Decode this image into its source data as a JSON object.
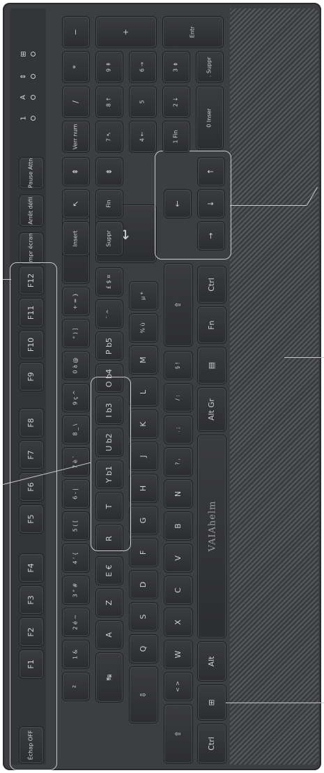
{
  "brand": "VAIAhelm",
  "indicators": [
    "1",
    "A",
    "⇕",
    "⊞"
  ],
  "keys": {
    "esc": "Échap\nOFF",
    "f1": "F1",
    "f2": "F2",
    "f3": "F3",
    "f4": "F4",
    "f5": "F5",
    "f6": "F6",
    "f7": "F7",
    "f8": "F8",
    "f9": "F9",
    "f10": "F10",
    "f11": "F11",
    "f12": "F12",
    "prt": "Impr\nécran",
    "scroll": "Arrêt\ndéfil",
    "pause": "Pause\nAttn",
    "sq": "²",
    "n1": "1 &",
    "n2": "2 é ~",
    "n3": "3 \" #",
    "n4": "4 ' {",
    "n5": "5 ( [",
    "n6": "6 - |",
    "n7": "7 è `",
    "n8": "8 _ \\",
    "n9": "9 ç ^",
    "n0": "0 à @",
    "deg": "° ) ]",
    "plus": "+ = }",
    "back": "←",
    "tab": "↹",
    "a": "A",
    "z": "Z",
    "e": "E €",
    "r": "R",
    "t": "T",
    "y": "Y b1",
    "u": "U b2",
    "i": "I b3",
    "o": "O b4",
    "p": "P b5",
    "circ": "¨ ^",
    "pound": "£ $ ¤",
    "enter": "↵",
    "caps": "⇩",
    "q": "Q",
    "s": "S",
    "d": "D",
    "f": "F",
    "g": "G",
    "h": "H",
    "j": "J",
    "k": "K",
    "l": "L",
    "m": "M",
    "pct": "% ù",
    "mu": "µ *",
    "lshift": "⇧",
    "lt": "< >",
    "w": "W",
    "x": "X",
    "c": "C",
    "v": "V",
    "b": "B",
    "nn": "N",
    "comma": "? ,",
    "semi": ". ;",
    "colon": "/ :",
    "excl": "§ !",
    "rshift": "⇧",
    "lctrl": "Ctrl",
    "win": "⊞",
    "alt": "Alt",
    "space": "",
    "altgr": "Alt Gr",
    "menu": "▤",
    "fn": "Fn",
    "rctrl": "Ctrl",
    "ins": "Insert",
    "home": "↖",
    "pgup": "⇞",
    "del": "Suppr",
    "end": "Fin",
    "pgdn": "⇟",
    "up": "↑",
    "left": "←",
    "down": "↓",
    "right": "→",
    "num": "Verr\nnum",
    "slash": "/",
    "star": "*",
    "minus": "−",
    "k7": "7 ↖",
    "k8": "8 ↑",
    "k9": "9 ⇞",
    "kplus": "+",
    "k4": "4 ←",
    "k5": "5",
    "k6": "6 →",
    "k1": "1 Fin",
    "k2": "2 ↓",
    "k3": "3 ⇟",
    "kenter": "Entr",
    "k0": "0 Inser",
    "kdot": ". Suppr"
  }
}
